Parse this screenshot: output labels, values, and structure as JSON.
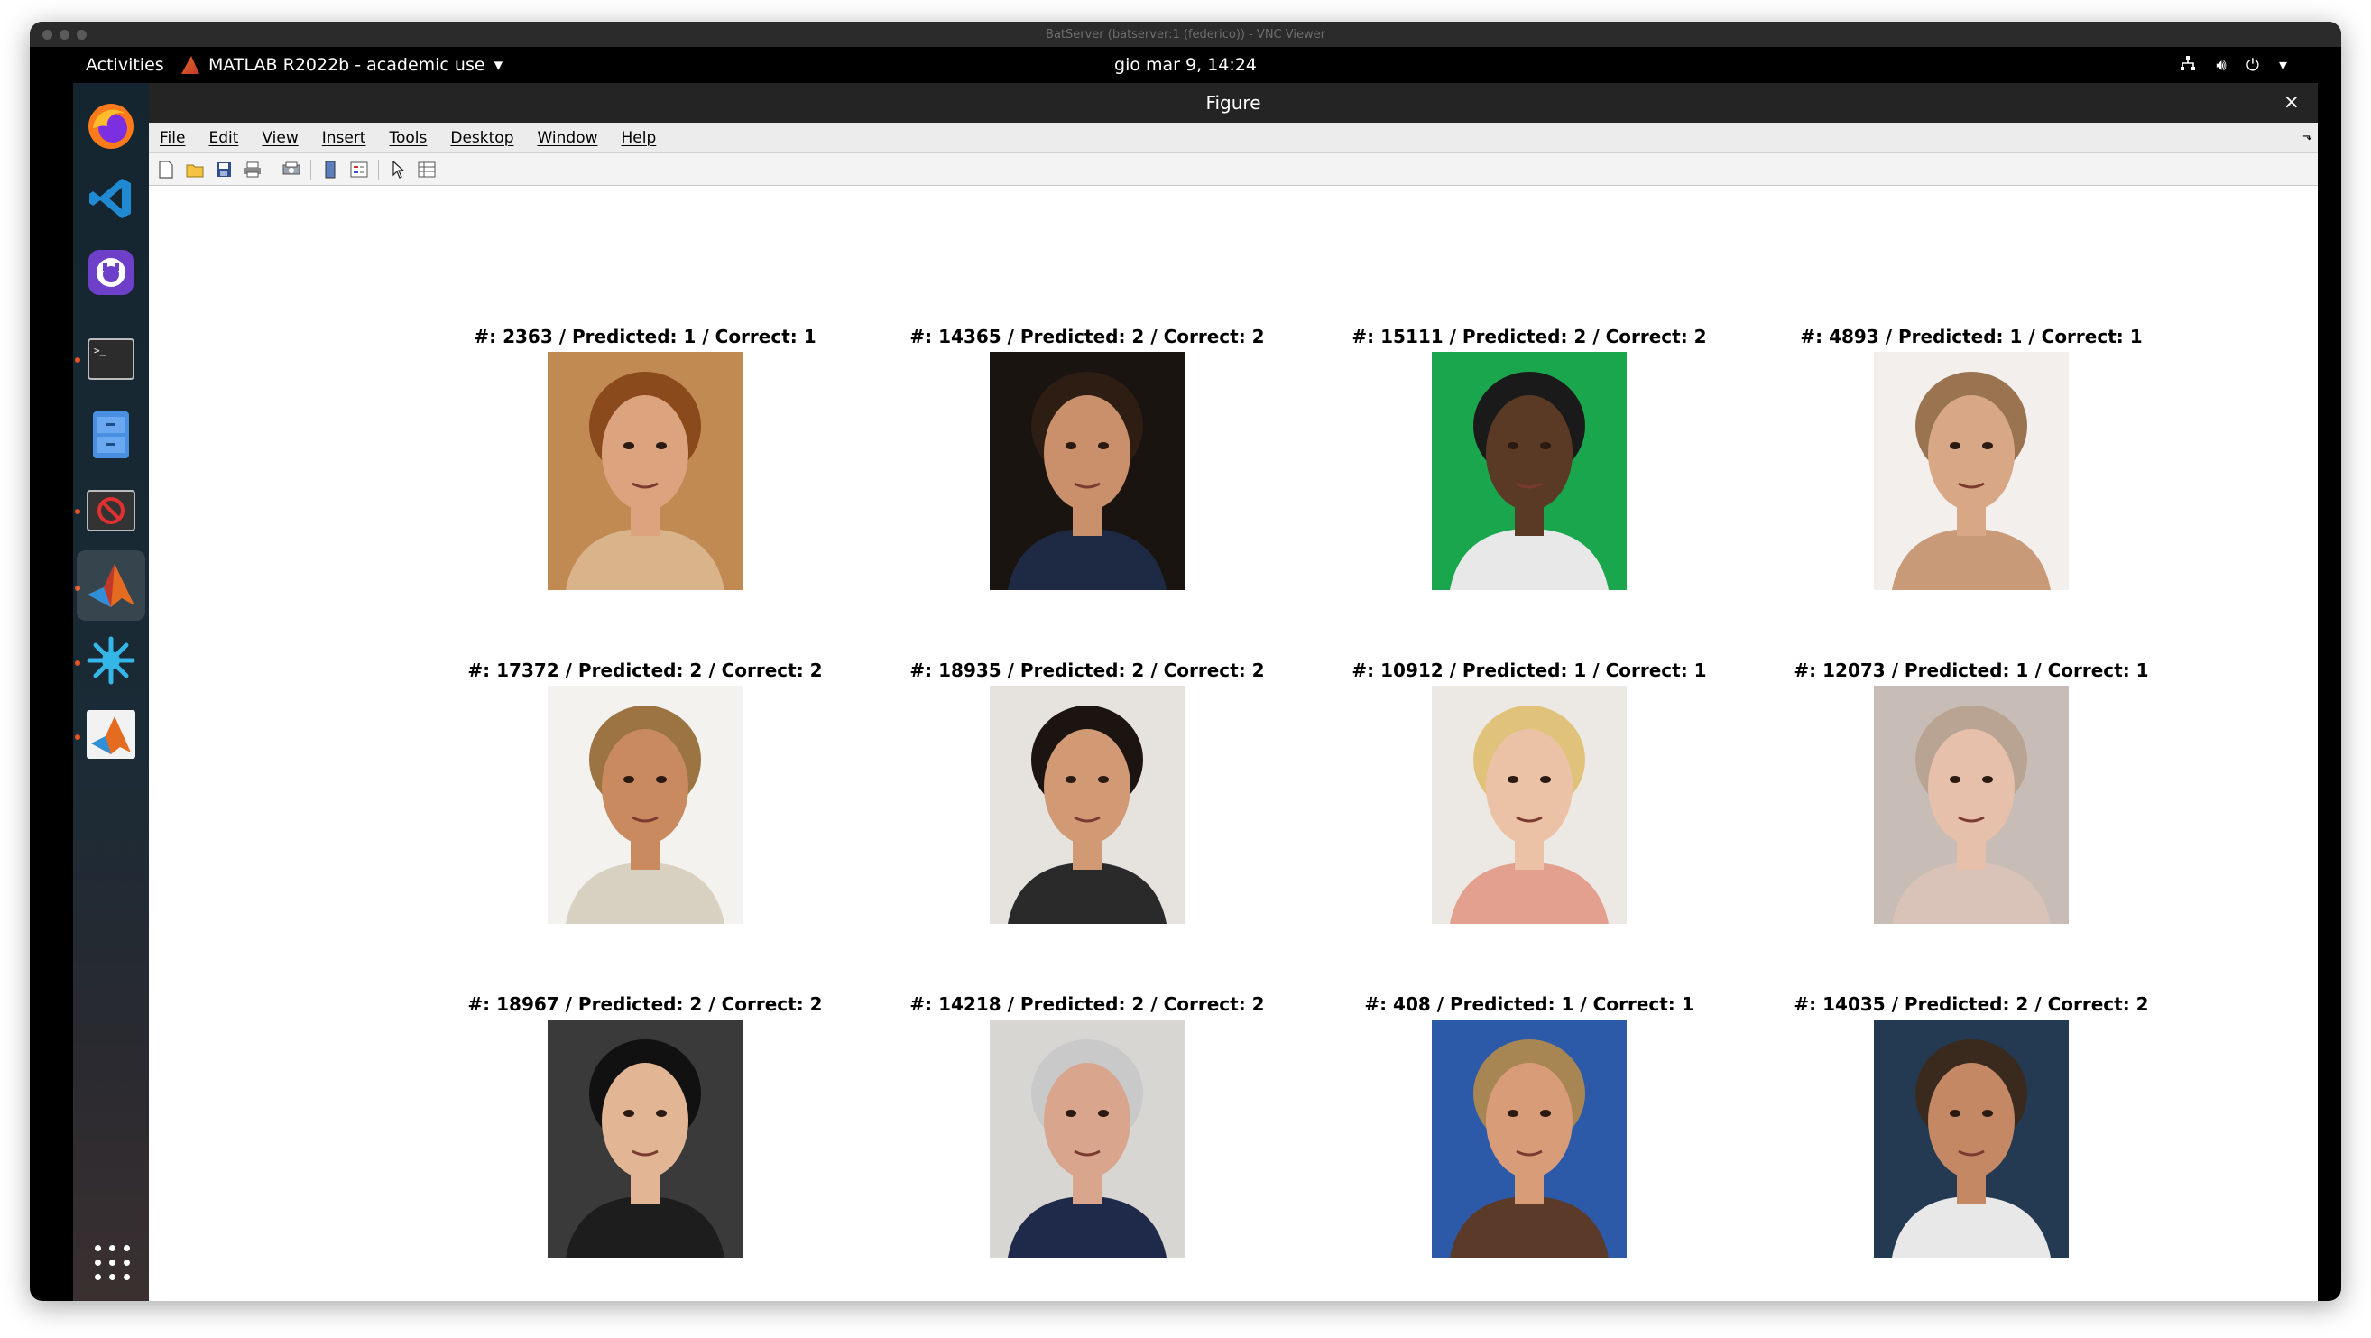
{
  "vnc": {
    "title": "BatServer (batserver:1 (federico)) - VNC Viewer"
  },
  "topbar": {
    "activities": "Activities",
    "app_name": "MATLAB R2022b - academic use",
    "clock": "gio mar  9, 14:24"
  },
  "dock": {
    "items": [
      "firefox-icon",
      "vscode-icon",
      "github-desktop-icon",
      "terminal-icon",
      "file-cabinet-icon",
      "stop-app-icon",
      "matlab-icon",
      "star-app-icon",
      "matlab-alt-icon"
    ]
  },
  "figure": {
    "title": "Figure",
    "close": "×",
    "menu": [
      "File",
      "Edit",
      "View",
      "Insert",
      "Tools",
      "Desktop",
      "Window",
      "Help"
    ]
  },
  "subplots": [
    {
      "title": "#: 2363 / Predicted: 1 / Correct: 1",
      "bg": "#c08a52",
      "face": "#dba47e",
      "hair": "#8a4a1c",
      "cloth": "#d9b48a"
    },
    {
      "title": "#: 14365 / Predicted: 2 / Correct: 2",
      "bg": "#1a1410",
      "face": "#c9906b",
      "hair": "#2e1d12",
      "cloth": "#1e2a44"
    },
    {
      "title": "#: 15111 / Predicted: 2 / Correct: 2",
      "bg": "#1aa64d",
      "face": "#5a3a25",
      "hair": "#1a1a1a",
      "cloth": "#e8e8e8"
    },
    {
      "title": "#: 4893 / Predicted: 1 / Correct: 1",
      "bg": "#f2efec",
      "face": "#d8a785",
      "hair": "#9a7450",
      "cloth": "#c89a78"
    },
    {
      "title": "#: 17372 / Predicted: 2 / Correct: 2",
      "bg": "#f4f2ef",
      "face": "#c98a60",
      "hair": "#9b7442",
      "cloth": "#d8d0c0"
    },
    {
      "title": "#: 18935 / Predicted: 2 / Correct: 2",
      "bg": "#e6e3df",
      "face": "#d19a75",
      "hair": "#1c1410",
      "cloth": "#2a2a2a"
    },
    {
      "title": "#: 10912 / Predicted: 1 / Correct: 1",
      "bg": "#ece8e3",
      "face": "#ecc2a6",
      "hair": "#e0c27a",
      "cloth": "#e3a08f"
    },
    {
      "title": "#: 12073 / Predicted: 1 / Correct: 1",
      "bg": "#c7bcb6",
      "face": "#e7c0ac",
      "hair": "#b9a393",
      "cloth": "#d9c2b7"
    },
    {
      "title": "#: 18967 / Predicted: 2 / Correct: 2",
      "bg": "#3a3a3a",
      "face": "#e2b694",
      "hair": "#111111",
      "cloth": "#1d1d1d"
    },
    {
      "title": "#: 14218 / Predicted: 2 / Correct: 2",
      "bg": "#d8d6d2",
      "face": "#d9a58c",
      "hair": "#c9c9c9",
      "cloth": "#1f2a4a"
    },
    {
      "title": "#: 408 / Predicted: 1 / Correct: 1",
      "bg": "#2d5aa8",
      "face": "#d89c78",
      "hair": "#a88654",
      "cloth": "#5b3a2a"
    },
    {
      "title": "#: 14035 / Predicted: 2 / Correct: 2",
      "bg": "#243a52",
      "face": "#c48864",
      "hair": "#3a2a1e",
      "cloth": "#e8e8e8"
    }
  ]
}
